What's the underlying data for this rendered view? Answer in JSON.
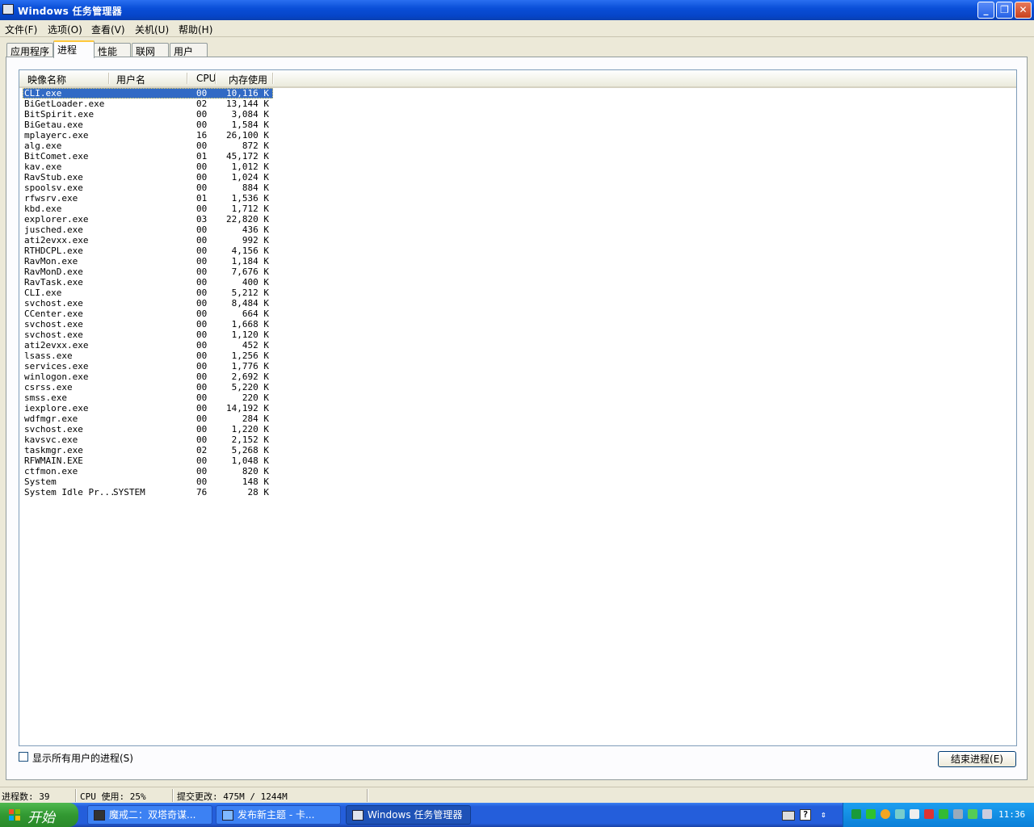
{
  "window": {
    "title": "Windows 任务管理器",
    "min": "_",
    "max": "❐",
    "close": "✕"
  },
  "menu": [
    "文件(F)",
    "选项(O)",
    "查看(V)",
    "关机(U)",
    "帮助(H)"
  ],
  "tabs": [
    "应用程序",
    "进程",
    "性能",
    "联网",
    "用户"
  ],
  "active_tab": "进程",
  "columns": {
    "name": "映像名称",
    "user": "用户名",
    "cpu": "CPU",
    "mem": "内存使用"
  },
  "processes": [
    {
      "name": "CLI.exe",
      "user": "",
      "cpu": "00",
      "mem": "10,116 K"
    },
    {
      "name": "BiGetLoader.exe",
      "user": "",
      "cpu": "02",
      "mem": "13,144 K"
    },
    {
      "name": "BitSpirit.exe",
      "user": "",
      "cpu": "00",
      "mem": "3,084 K"
    },
    {
      "name": "BiGetau.exe",
      "user": "",
      "cpu": "00",
      "mem": "1,584 K"
    },
    {
      "name": "mplayerc.exe",
      "user": "",
      "cpu": "16",
      "mem": "26,100 K"
    },
    {
      "name": "alg.exe",
      "user": "",
      "cpu": "00",
      "mem": "872 K"
    },
    {
      "name": "BitComet.exe",
      "user": "",
      "cpu": "01",
      "mem": "45,172 K"
    },
    {
      "name": "kav.exe",
      "user": "",
      "cpu": "00",
      "mem": "1,012 K"
    },
    {
      "name": "RavStub.exe",
      "user": "",
      "cpu": "00",
      "mem": "1,024 K"
    },
    {
      "name": "spoolsv.exe",
      "user": "",
      "cpu": "00",
      "mem": "884 K"
    },
    {
      "name": "rfwsrv.exe",
      "user": "",
      "cpu": "01",
      "mem": "1,536 K"
    },
    {
      "name": "kbd.exe",
      "user": "",
      "cpu": "00",
      "mem": "1,712 K"
    },
    {
      "name": "explorer.exe",
      "user": "",
      "cpu": "03",
      "mem": "22,820 K"
    },
    {
      "name": "jusched.exe",
      "user": "",
      "cpu": "00",
      "mem": "436 K"
    },
    {
      "name": "ati2evxx.exe",
      "user": "",
      "cpu": "00",
      "mem": "992 K"
    },
    {
      "name": "RTHDCPL.exe",
      "user": "",
      "cpu": "00",
      "mem": "4,156 K"
    },
    {
      "name": "RavMon.exe",
      "user": "",
      "cpu": "00",
      "mem": "1,184 K"
    },
    {
      "name": "RavMonD.exe",
      "user": "",
      "cpu": "00",
      "mem": "7,676 K"
    },
    {
      "name": "RavTask.exe",
      "user": "",
      "cpu": "00",
      "mem": "400 K"
    },
    {
      "name": "CLI.exe",
      "user": "",
      "cpu": "00",
      "mem": "5,212 K"
    },
    {
      "name": "svchost.exe",
      "user": "",
      "cpu": "00",
      "mem": "8,484 K"
    },
    {
      "name": "CCenter.exe",
      "user": "",
      "cpu": "00",
      "mem": "664 K"
    },
    {
      "name": "svchost.exe",
      "user": "",
      "cpu": "00",
      "mem": "1,668 K"
    },
    {
      "name": "svchost.exe",
      "user": "",
      "cpu": "00",
      "mem": "1,120 K"
    },
    {
      "name": "ati2evxx.exe",
      "user": "",
      "cpu": "00",
      "mem": "452 K"
    },
    {
      "name": "lsass.exe",
      "user": "",
      "cpu": "00",
      "mem": "1,256 K"
    },
    {
      "name": "services.exe",
      "user": "",
      "cpu": "00",
      "mem": "1,776 K"
    },
    {
      "name": "winlogon.exe",
      "user": "",
      "cpu": "00",
      "mem": "2,692 K"
    },
    {
      "name": "csrss.exe",
      "user": "",
      "cpu": "00",
      "mem": "5,220 K"
    },
    {
      "name": "smss.exe",
      "user": "",
      "cpu": "00",
      "mem": "220 K"
    },
    {
      "name": "iexplore.exe",
      "user": "",
      "cpu": "00",
      "mem": "14,192 K"
    },
    {
      "name": "wdfmgr.exe",
      "user": "",
      "cpu": "00",
      "mem": "284 K"
    },
    {
      "name": "svchost.exe",
      "user": "",
      "cpu": "00",
      "mem": "1,220 K"
    },
    {
      "name": "kavsvc.exe",
      "user": "",
      "cpu": "00",
      "mem": "2,152 K"
    },
    {
      "name": "taskmgr.exe",
      "user": "",
      "cpu": "02",
      "mem": "5,268 K"
    },
    {
      "name": "RFWMAIN.EXE",
      "user": "",
      "cpu": "00",
      "mem": "1,048 K"
    },
    {
      "name": "ctfmon.exe",
      "user": "",
      "cpu": "00",
      "mem": "820 K"
    },
    {
      "name": "System",
      "user": "",
      "cpu": "00",
      "mem": "148 K"
    },
    {
      "name": "System Idle Pr...",
      "user": "SYSTEM",
      "cpu": "76",
      "mem": "28 K"
    }
  ],
  "selected_index": 0,
  "show_all_users": {
    "label": "显示所有用户的进程(S)",
    "checked": false
  },
  "end_process_label": "结束进程(E)",
  "status": {
    "processes": "进程数: 39",
    "cpu": "CPU 使用: 25%",
    "commit": "提交更改: 475M / 1244M"
  },
  "taskbar": {
    "start": "开始",
    "tasks": [
      "魔戒二：双塔奇谋...",
      "发布新主题 - 卡...",
      "Windows 任务管理器"
    ],
    "active_task": 2,
    "clock": "11:36"
  },
  "colors": {
    "titlebar": "#0a4fd8",
    "selection": "#316ac5",
    "taskbar": "#245edb",
    "start": "#329932",
    "tray": "#0b7fd8"
  }
}
